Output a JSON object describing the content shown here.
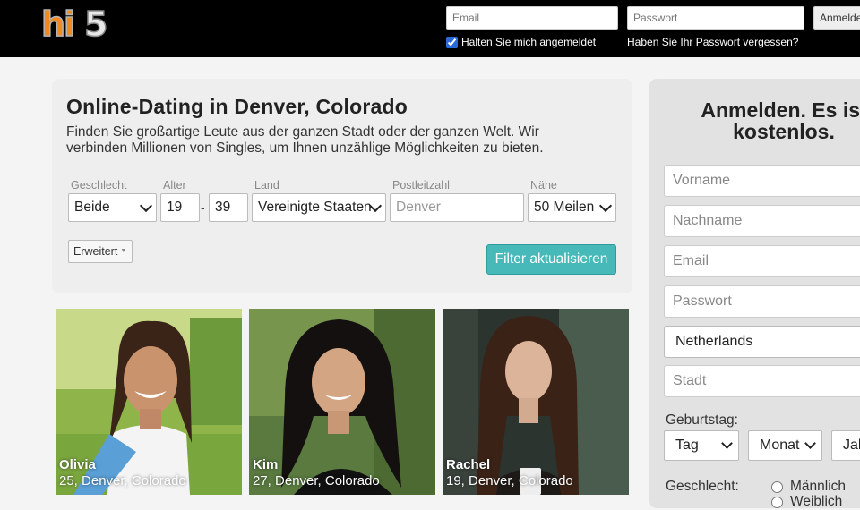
{
  "header": {
    "logo_text": "hi5",
    "email_placeholder": "Email",
    "password_placeholder": "Passwort",
    "login_button": "Anmelden",
    "remember_label": "Halten Sie mich angemeldet",
    "remember_checked": true,
    "forgot_link": "Haben Sie Ihr Passwort vergessen?"
  },
  "search": {
    "title": "Online-Dating in Denver, Colorado",
    "description": "Finden Sie großartige Leute aus der ganzen Stadt oder der ganzen Welt. Wir verbinden Millionen von Singles, um Ihnen unzählige Möglichkeiten zu bieten.",
    "labels": {
      "gender": "Geschlecht",
      "age": "Alter",
      "country": "Land",
      "zip": "Postleitzahl",
      "distance": "Nähe"
    },
    "gender_value": "Beide",
    "age_min": "19",
    "age_separator": "-",
    "age_max": "39",
    "country_value": "Vereinigte Staaten",
    "zip_placeholder": "Denver",
    "distance_value": "50 Meilen",
    "advanced_button": "Erweitert",
    "filter_button": "Filter aktualisieren"
  },
  "profiles": [
    {
      "name": "Olivia",
      "info": "25, Denver, Colorado"
    },
    {
      "name": "Kim",
      "info": "27, Denver, Colorado"
    },
    {
      "name": "Rachel",
      "info": "19, Denver, Colorado"
    }
  ],
  "signup": {
    "title": "Anmelden. Es ist kostenlos.",
    "firstname_placeholder": "Vorname",
    "lastname_placeholder": "Nachname",
    "email_placeholder": "Email",
    "password_placeholder": "Passwort",
    "country_value": "Netherlands",
    "city_placeholder": "Stadt",
    "birthday_label": "Geburtstag:",
    "day_select": "Tag",
    "month_select": "Monat",
    "year_select": "Jahr",
    "gender_label": "Geschlecht:",
    "gender_male": "Männlich",
    "gender_female": "Weiblich"
  },
  "colors": {
    "topbar": "#000000",
    "accent_button": "#48b9b9",
    "logo_orange": "#f08a1c"
  }
}
